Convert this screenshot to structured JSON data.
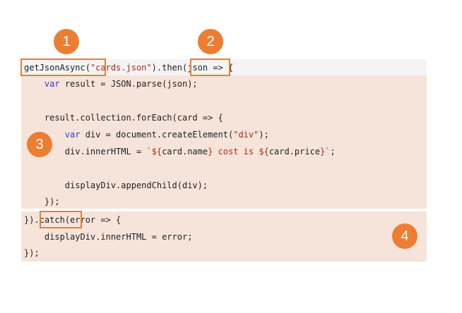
{
  "colors": {
    "accent": "#ed7d31",
    "keyword": "#2b3fc9",
    "string": "#b0271f",
    "code_bg_light": "#f4f4f4",
    "code_bg_peach": "#f6e4da"
  },
  "badges": [
    "1",
    "2",
    "3",
    "4"
  ],
  "code": {
    "line1": {
      "fn": "getJsonAsync",
      "open_paren": "(",
      "arg": "\"cards.json\"",
      "close_paren": ")",
      "then": ".then",
      "rest": "(json => {"
    },
    "line2": {
      "indent": "    ",
      "kw": "var",
      "rest": " result = JSON.parse(json);"
    },
    "line3": {
      "indent": "    ",
      "text": "result.collection.forEach(card => {"
    },
    "line4": {
      "indent": "        ",
      "kw": "var",
      "before_str": " div = document.createElement(",
      "str": "\"div\"",
      "after_str": ");"
    },
    "line5": {
      "indent": "        ",
      "before": "div.innerHTML = ",
      "tmpl_a": "`${",
      "expr_a": "card.name",
      "tmpl_b": "} cost is ${",
      "expr_b": "card.price",
      "tmpl_c": "}`",
      "after": ";"
    },
    "line6": {
      "indent": "        ",
      "text": "displayDiv.appendChild(div);"
    },
    "line7": {
      "indent": "    ",
      "text": "});"
    },
    "line8": {
      "prefix": "}).",
      "catch": "catch",
      "rest": "(error => {"
    },
    "line9": {
      "indent": "    ",
      "text": "displayDiv.innerHTML = error;"
    },
    "line10": {
      "text": "});"
    }
  }
}
